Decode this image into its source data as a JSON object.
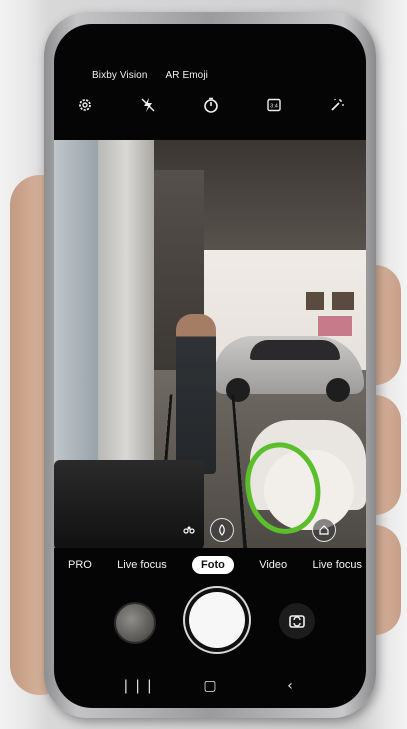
{
  "top_modes": [
    "Bixby Vision",
    "AR Emoji"
  ],
  "top_icons": [
    "settings-icon",
    "flash-off-icon",
    "timer-icon",
    "aspect-ratio-icon",
    "filter-icon"
  ],
  "aspect_ratio_label": "3:4",
  "camera_modes": [
    {
      "label": "PRO",
      "selected": false
    },
    {
      "label": "Live focus",
      "selected": false
    },
    {
      "label": "Foto",
      "selected": true
    },
    {
      "label": "Video",
      "selected": false
    },
    {
      "label": "Live focus",
      "selected": false
    }
  ],
  "nav_icons": [
    "recent-apps-icon",
    "home-icon",
    "back-icon"
  ],
  "colors": {
    "focus_highlight": "#5bbf2b",
    "selected_mode_bg": "#ffffff"
  }
}
